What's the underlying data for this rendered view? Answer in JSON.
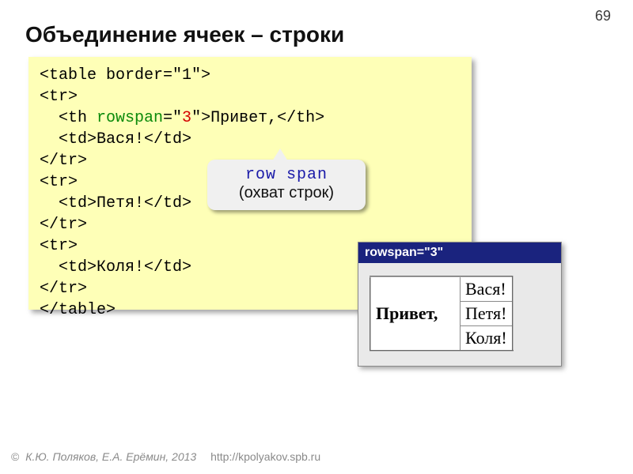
{
  "page_number": "69",
  "title": "Объединение ячеек – строки",
  "code": {
    "l1": "<table border=\"1\">",
    "l2": "<tr>",
    "l3a": "  <th ",
    "l3_attr": "rowspan",
    "l3b": "=\"",
    "l3_val": "3",
    "l3c": "\">Привет,</th>",
    "l4": "  <td>Вася!</td>",
    "l5": "</tr>",
    "l6": "<tr>",
    "l7": "  <td>Петя!</td>",
    "l8": "</tr>",
    "l9": "<tr>",
    "l10": "  <td>Коля!</td>",
    "l11": "</tr>",
    "l12": "</table>"
  },
  "callout": {
    "line1": "row span",
    "line2": "(охват строк)"
  },
  "preview": {
    "titlebar": "rowspan=\"3\"",
    "th": "Привет,",
    "td1": "Вася!",
    "td2": "Петя!",
    "td3": "Коля!"
  },
  "footer": {
    "copy": "©",
    "text": "К.Ю. Поляков, Е.А. Ерёмин, 2013",
    "link": "http://kpolyakov.spb.ru"
  }
}
